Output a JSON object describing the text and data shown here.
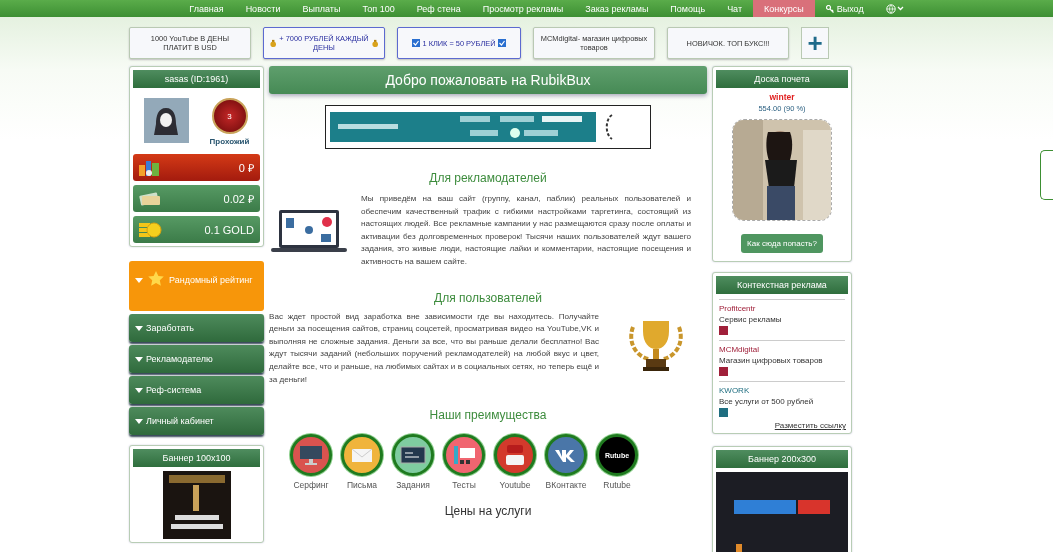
{
  "nav": [
    {
      "label": "Главная",
      "selected": false,
      "kind": "text"
    },
    {
      "label": "Новости",
      "selected": false,
      "kind": "text"
    },
    {
      "label": "Выплаты",
      "selected": false,
      "kind": "text"
    },
    {
      "label": "Топ 100",
      "selected": false,
      "kind": "text"
    },
    {
      "label": "Реф стена",
      "selected": false,
      "kind": "text"
    },
    {
      "label": "Просмотр рекламы",
      "selected": false,
      "kind": "text"
    },
    {
      "label": "Заказ рекламы",
      "selected": false,
      "kind": "text"
    },
    {
      "label": "Помощь",
      "selected": false,
      "kind": "text"
    },
    {
      "label": "Чат",
      "selected": false,
      "kind": "text"
    },
    {
      "label": "Конкурсы",
      "selected": true,
      "kind": "text"
    },
    {
      "label": "Выход",
      "selected": false,
      "kind": "logout"
    }
  ],
  "ad_strip": [
    {
      "text": "1000 YouTube В ДЕНЫ ПЛАТИТ В USD",
      "kind": "plain"
    },
    {
      "text": "+ 7000 РУБЛЕЙ КАЖДЫЙ ДЕНЫ",
      "kind": "bags"
    },
    {
      "text": "1 КЛИК = 50 РУБЛЕЙ",
      "kind": "checks"
    },
    {
      "text": "MCMdigital- магазин цифровых товаров",
      "kind": "plain"
    },
    {
      "text": "НОВИЧОК. ТОП БУКС!!!",
      "kind": "plain"
    }
  ],
  "add_button": "+",
  "user_card": {
    "title": "sasas (ID:1961)",
    "rank_number": "3",
    "rank": "Прохожий",
    "balances": [
      {
        "kind": "main",
        "value": "0 ₽"
      },
      {
        "kind": "bonus",
        "value": "0.02 ₽"
      },
      {
        "kind": "gold",
        "value": "0.1 GOLD"
      }
    ]
  },
  "menu": [
    {
      "label": "Рандомный рейтинг",
      "selected": true
    },
    {
      "label": "Заработать",
      "selected": false
    },
    {
      "label": "Рекламодателю",
      "selected": false
    },
    {
      "label": "Реф-система",
      "selected": false
    },
    {
      "label": "Личный кабинет",
      "selected": false
    }
  ],
  "banner_small": {
    "title": "Баннер 100x100"
  },
  "welcome": "Добро пожаловать на RubikBux",
  "advertisers": {
    "title": "Для рекламодателей",
    "text": "Мы приведём на ваш сайт (группу, канал, паблик) реальных пользователей и обеспечим качественный трафик с гибкими настройками таргетинга, состоящий из настоящих людей. Все рекламные кампании у нас размещаются сразу после оплаты и активации без долговременных проверок! Тысячи наших пользователей ждут вашего задания, это живые люди, настоящие лайки и комментарии, настоящие посещения и активность на вашем сайте."
  },
  "users": {
    "title": "Для пользователей",
    "text": "Вас ждет простой вид заработка вне зависимости где вы находитесь. Получайте деньги за посещения сайтов, страниц соцсетей, просматривая видео на YouTube,VK и выполняя не сложные задания. Деньги за все, что вы раньше делали бесплатно! Вас ждут тысячи заданий (небольших поручений рекламодателей) на любой вкус и цвет, делайте все, что и раньше, на любимых сайтах и в социальных сетях, но теперь ещё и за деньги!"
  },
  "advantages": {
    "title": "Наши преимущества",
    "items": [
      {
        "kind": "monitor",
        "label": "Серфинг"
      },
      {
        "kind": "mail",
        "label": "Письма"
      },
      {
        "kind": "board",
        "label": "Задания"
      },
      {
        "kind": "test",
        "label": "Тесты"
      },
      {
        "kind": "youtube",
        "label": "Youtube"
      },
      {
        "kind": "vk",
        "label": "ВКонтакте"
      },
      {
        "kind": "rutube",
        "label": "Rutube",
        "badge": "Rutube"
      }
    ]
  },
  "prices_title": "Цены на услуги",
  "honor": {
    "title": "Доска почета",
    "name": "winter",
    "score": "554.00 (90 %)",
    "button": "Как сюда попасть?"
  },
  "context_ads": {
    "title": "Контекстная реклама",
    "items": [
      {
        "title": "Profitcentr",
        "text": "Сервис рекламы",
        "color": "#a0203a"
      },
      {
        "title": "MCMdigital",
        "text": "Магазин цифровых товаров",
        "color": "#a0203a"
      },
      {
        "title": "KWORK",
        "text": "Все услуги от 500 рублей",
        "color": "#1f6e80"
      }
    ],
    "link": "Разместить ссылку"
  },
  "banner_large": {
    "title": "Баннер 200x300"
  }
}
